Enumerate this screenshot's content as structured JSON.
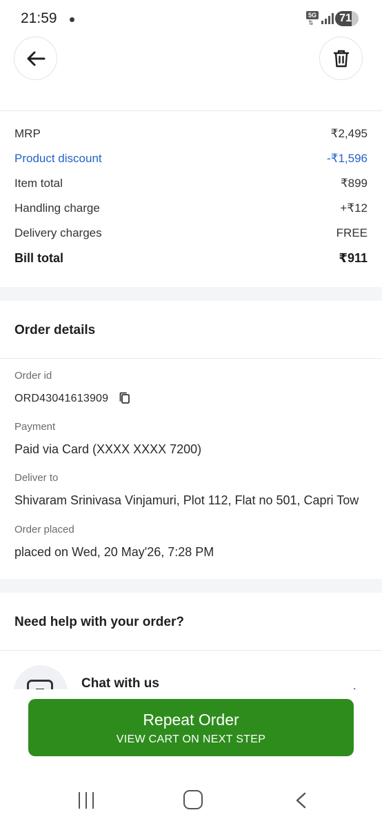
{
  "status_bar": {
    "time": "21:59",
    "network": "5G",
    "battery": "71"
  },
  "header": {
    "back_icon": "arrow-left-icon",
    "delete_icon": "trash-icon"
  },
  "bill": {
    "rows": [
      {
        "label": "MRP",
        "value": "₹2,495"
      },
      {
        "label": "Product discount",
        "value": "-₹1,596"
      },
      {
        "label": "Item total",
        "value": "₹899"
      },
      {
        "label": "Handling charge",
        "value": "+₹12"
      },
      {
        "label": "Delivery charges",
        "value": "FREE"
      },
      {
        "label": "Bill total",
        "value": "₹911"
      }
    ],
    "discount_color": "#2563c8"
  },
  "order_details": {
    "title": "Order details",
    "order_id_label": "Order id",
    "order_id": "ORD43041613909",
    "payment_label": "Payment",
    "payment": "Paid via Card (XXXX XXXX 7200)",
    "deliver_to_label": "Deliver to",
    "deliver_to": "Shivaram Srinivasa Vinjamuri, Plot 112, Flat no 501, Capri Tow",
    "order_placed_label": "Order placed",
    "order_placed": "placed on Wed, 20 May'26, 7:28 PM"
  },
  "help": {
    "title": "Need help with your order?",
    "chat_label": "Chat with us"
  },
  "repeat_order": {
    "label": "Repeat Order",
    "sublabel": "VIEW CART ON NEXT STEP",
    "color": "#2e8c1d"
  }
}
